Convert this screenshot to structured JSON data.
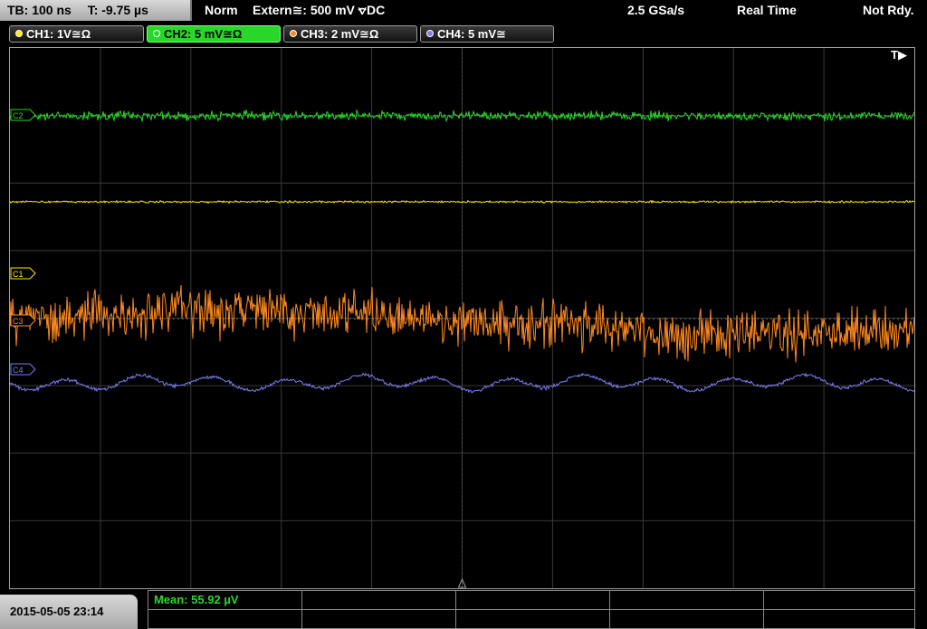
{
  "topbar": {
    "timebase": "TB: 100 ns",
    "trigger_time": "T: -9.75 µs",
    "mode": "Norm",
    "trigger_source": "Extern≅: 500 mV ⦡DC",
    "sample_rate": "2.5 GSa/s",
    "acq_mode": "Real Time",
    "status": "Not Rdy."
  },
  "channels": [
    {
      "id": "ch1",
      "label": "CH1: 1V≅Ω",
      "color": "#ffee00",
      "marker": "C1"
    },
    {
      "id": "ch2",
      "label": "CH2: 5 mV≅Ω",
      "color": "#2bd62b",
      "marker": "C2"
    },
    {
      "id": "ch3",
      "label": "CH3: 2 mV≅Ω",
      "color": "#ff8a20",
      "marker": "C3"
    },
    {
      "id": "ch4",
      "label": "CH4: 5 mV≅",
      "color": "#7c7cf0",
      "marker": "C4"
    }
  ],
  "trigger_marker": "T▶",
  "datetime": "2015-05-05 23:14",
  "measurement": {
    "mean": "Mean: 55.92 µV"
  },
  "icons": [
    "trigger-position-icon",
    "ground-level-icon"
  ]
}
